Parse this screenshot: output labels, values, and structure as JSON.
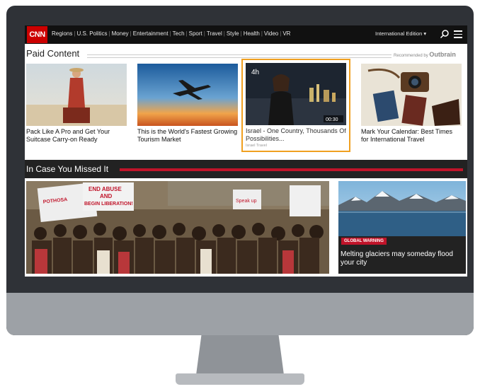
{
  "header": {
    "logo": "CNN",
    "nav": [
      "Regions",
      "U.S. Politics",
      "Money",
      "Entertainment",
      "Tech",
      "Sport",
      "Travel",
      "Style",
      "Health",
      "Video",
      "VR"
    ],
    "edition": "International Edition ▾"
  },
  "paid": {
    "title": "Paid Content",
    "recommended": "Recommended by",
    "brand": "Outbrain",
    "cards": [
      {
        "caption": "Pack Like A Pro and Get Your Suitcase Carry-on Ready"
      },
      {
        "caption": "This is the World's Fastest Growing Tourism Market"
      },
      {
        "caption": "Israel - One Country, Thousands Of Possibilities...",
        "source": "Israel Travel",
        "overlay_badge": "4h",
        "duration": "00:30"
      },
      {
        "caption": "Mark Your Calendar: Best Times for International Travel"
      }
    ]
  },
  "icymi": {
    "title": "In Case You Missed It",
    "big_story": {
      "sign_text_1": "END ABUSE AND BEGIN LIBERATION!",
      "sign_text_2": "Speak up"
    },
    "side_story": {
      "badge": "GLOBAL WARNING",
      "caption": "Melting glaciers may someday flood your city"
    }
  },
  "colors": {
    "brand_red": "#cc0000",
    "accent_red": "#c0142a",
    "highlight": "#f0a020"
  }
}
